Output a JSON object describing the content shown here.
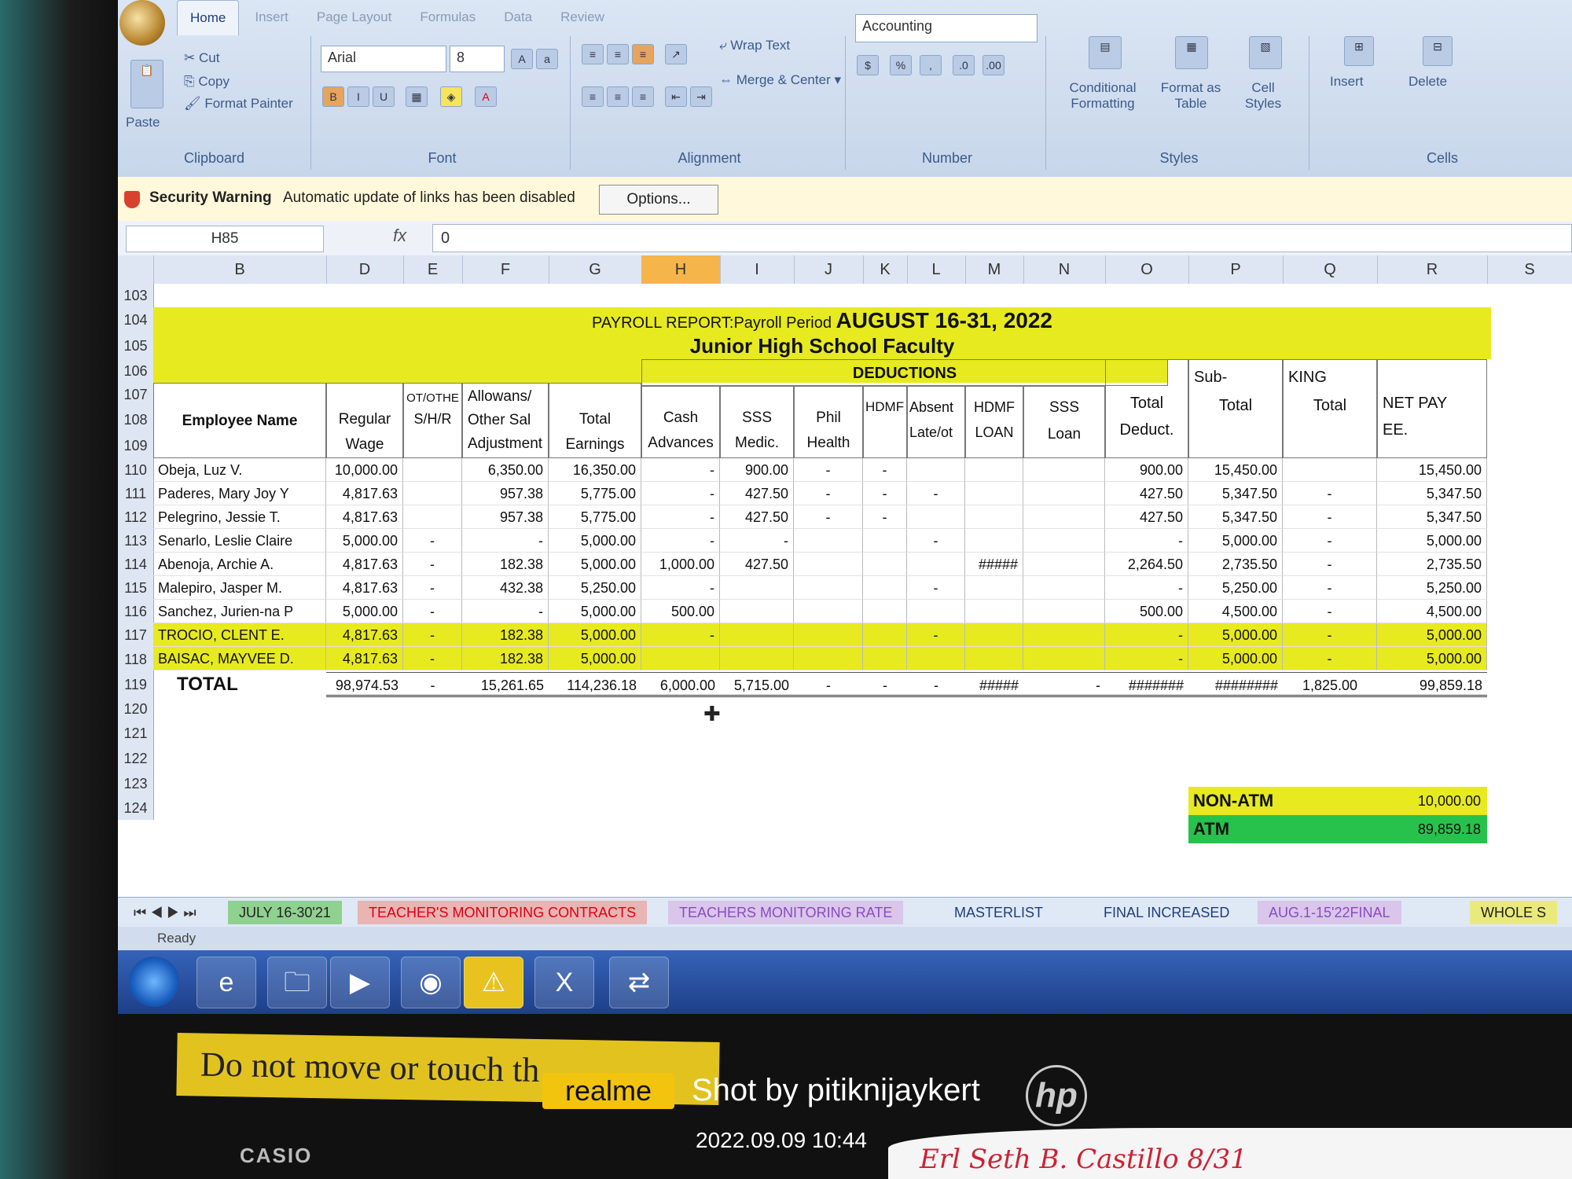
{
  "ribbon": {
    "tabs": [
      "Home",
      "Insert",
      "Page Layout",
      "Formulas",
      "Data",
      "Review"
    ],
    "clipboard": {
      "paste": "Paste",
      "cut": "Cut",
      "copy": "Copy",
      "format_painter": "Format Painter",
      "label": "Clipboard"
    },
    "font": {
      "name": "Arial",
      "size": "8",
      "label": "Font"
    },
    "alignment": {
      "wrap": "Wrap Text",
      "merge": "Merge & Center",
      "label": "Alignment"
    },
    "number": {
      "format": "Accounting",
      "label": "Number"
    },
    "styles": {
      "conditional": "Conditional Formatting",
      "format_table": "Format as Table",
      "cell_styles": "Cell Styles",
      "label": "Styles"
    },
    "cells": {
      "insert": "Insert",
      "delete": "Delete",
      "label": "Cells"
    }
  },
  "security": {
    "title": "Security Warning",
    "message": "Automatic update of links has been disabled",
    "options": "Options..."
  },
  "formula_bar": {
    "name_box": "H85",
    "fx": "fx",
    "value": "0"
  },
  "columns": [
    "B",
    "D",
    "E",
    "F",
    "G",
    "H",
    "I",
    "J",
    "K",
    "L",
    "M",
    "N",
    "O",
    "P",
    "Q",
    "R",
    "S"
  ],
  "row_numbers": [
    "103",
    "104",
    "105",
    "106",
    "107",
    "108",
    "109",
    "110",
    "111",
    "112",
    "113",
    "114",
    "115",
    "116",
    "117",
    "118",
    "119",
    "120",
    "121",
    "122",
    "123",
    "124"
  ],
  "report": {
    "title_prefix": "PAYROLL REPORT:Payroll Period",
    "title_period": "AUGUST 16-31, 2022",
    "subtitle": "Junior High School Faculty"
  },
  "headers": {
    "employee_name": "Employee Name",
    "regular": "Regular",
    "wage": "Wage",
    "ot_othe": "OT/OTHE",
    "shr": "S/H/R",
    "allowans": "Allowans/",
    "other_sal": "Other Sal",
    "adjustment": "Adjustment",
    "total": "Total",
    "earnings": "Earnings",
    "deductions": "DEDUCTIONS",
    "cash": "Cash",
    "advances": "Advances",
    "sss": "SSS",
    "medic": "Medic.",
    "phil": "Phil",
    "health": "Health",
    "hdmf1": "HDMF",
    "absent": "Absent",
    "late": "Late/ot",
    "hdmf2": "HDMF",
    "loan": "LOAN",
    "sss_loan1": "SSS",
    "sss_loan2": "Loan",
    "total_deduct1": "Total",
    "total_deduct2": "Deduct.",
    "sub1": "Sub-",
    "sub2": "Total",
    "king1": "KING",
    "king2": "Total",
    "net1": "NET PAY",
    "net2": "EE."
  },
  "rows": [
    {
      "name": "Obeja, Luz V.",
      "reg": "10,000.00",
      "ot": "",
      "allow": "6,350.00",
      "earn": "16,350.00",
      "cash": "-",
      "sss": "900.00",
      "phil": "-",
      "hdmf": "-",
      "absent": "",
      "hloan": "",
      "sloan": "",
      "tded": "900.00",
      "sub": "15,450.00",
      "king": "",
      "net": "15,450.00",
      "hl": false
    },
    {
      "name": "Paderes, Mary Joy Y",
      "reg": "4,817.63",
      "ot": "",
      "allow": "957.38",
      "earn": "5,775.00",
      "cash": "-",
      "sss": "427.50",
      "phil": "-",
      "hdmf": "-",
      "absent": "-",
      "hloan": "",
      "sloan": "",
      "tded": "427.50",
      "sub": "5,347.50",
      "king": "-",
      "net": "5,347.50",
      "hl": false
    },
    {
      "name": "Pelegrino, Jessie T.",
      "reg": "4,817.63",
      "ot": "",
      "allow": "957.38",
      "earn": "5,775.00",
      "cash": "-",
      "sss": "427.50",
      "phil": "-",
      "hdmf": "-",
      "absent": "",
      "hloan": "",
      "sloan": "",
      "tded": "427.50",
      "sub": "5,347.50",
      "king": "-",
      "net": "5,347.50",
      "hl": false
    },
    {
      "name": "Senarlo, Leslie Claire",
      "reg": "5,000.00",
      "ot": "-",
      "allow": "-",
      "earn": "5,000.00",
      "cash": "-",
      "sss": "-",
      "phil": "",
      "hdmf": "",
      "absent": "-",
      "hloan": "",
      "sloan": "",
      "tded": "-",
      "sub": "5,000.00",
      "king": "-",
      "net": "5,000.00",
      "hl": false
    },
    {
      "name": "Abenoja, Archie A.",
      "reg": "4,817.63",
      "ot": "-",
      "allow": "182.38",
      "earn": "5,000.00",
      "cash": "1,000.00",
      "sss": "427.50",
      "phil": "",
      "hdmf": "",
      "absent": "",
      "hloan": "#####",
      "sloan": "",
      "tded": "2,264.50",
      "sub": "2,735.50",
      "king": "-",
      "net": "2,735.50",
      "hl": false
    },
    {
      "name": "Malepiro, Jasper M.",
      "reg": "4,817.63",
      "ot": "-",
      "allow": "432.38",
      "earn": "5,250.00",
      "cash": "-",
      "sss": "",
      "phil": "",
      "hdmf": "",
      "absent": "-",
      "hloan": "",
      "sloan": "",
      "tded": "-",
      "sub": "5,250.00",
      "king": "-",
      "net": "5,250.00",
      "hl": false
    },
    {
      "name": "Sanchez, Jurien-na P",
      "reg": "5,000.00",
      "ot": "-",
      "allow": "-",
      "earn": "5,000.00",
      "cash": "500.00",
      "sss": "",
      "phil": "",
      "hdmf": "",
      "absent": "",
      "hloan": "",
      "sloan": "",
      "tded": "500.00",
      "sub": "4,500.00",
      "king": "-",
      "net": "4,500.00",
      "hl": false
    },
    {
      "name": "TROCIO, CLENT E.",
      "reg": "4,817.63",
      "ot": "-",
      "allow": "182.38",
      "earn": "5,000.00",
      "cash": "-",
      "sss": "",
      "phil": "",
      "hdmf": "",
      "absent": "-",
      "hloan": "",
      "sloan": "",
      "tded": "-",
      "sub": "5,000.00",
      "king": "-",
      "net": "5,000.00",
      "hl": true
    },
    {
      "name": "BAISAC, MAYVEE D.",
      "reg": "4,817.63",
      "ot": "-",
      "allow": "182.38",
      "earn": "5,000.00",
      "cash": "",
      "sss": "",
      "phil": "",
      "hdmf": "",
      "absent": "",
      "hloan": "",
      "sloan": "",
      "tded": "-",
      "sub": "5,000.00",
      "king": "-",
      "net": "5,000.00",
      "hl": true
    }
  ],
  "total_row": {
    "label": "TOTAL",
    "reg": "98,974.53",
    "ot": "-",
    "allow": "15,261.65",
    "earn": "114,236.18",
    "cash": "6,000.00",
    "sss": "5,715.00",
    "phil": "-",
    "hdmf": "-",
    "absent": "-",
    "hloan": "#####",
    "sloan": "-",
    "tded": "#######",
    "sub": "########",
    "king": "1,825.00",
    "net": "99,859.18"
  },
  "summary": {
    "non_atm_label": "NON-ATM",
    "non_atm_value": "10,000.00",
    "atm_label": "ATM",
    "atm_value": "89,859.18"
  },
  "sheet_tabs": [
    "JULY 16-30'21",
    "TEACHER'S MONITORING CONTRACTS",
    "TEACHERS MONITORING RATE",
    "MASTERLIST",
    "FINAL INCREASED",
    "AUG.1-15'22FINAL",
    "WHOLE S"
  ],
  "status": "Ready",
  "photo": {
    "note": "Do not move or touch th",
    "brand": "realme",
    "shot_by": "Shot by pitiknijaykert",
    "timestamp": "2022.09.09 10:44",
    "monitor_brand": "hp",
    "casio": "CASIO",
    "handwriting": "Erl Seth B. Castillo 8/31"
  }
}
